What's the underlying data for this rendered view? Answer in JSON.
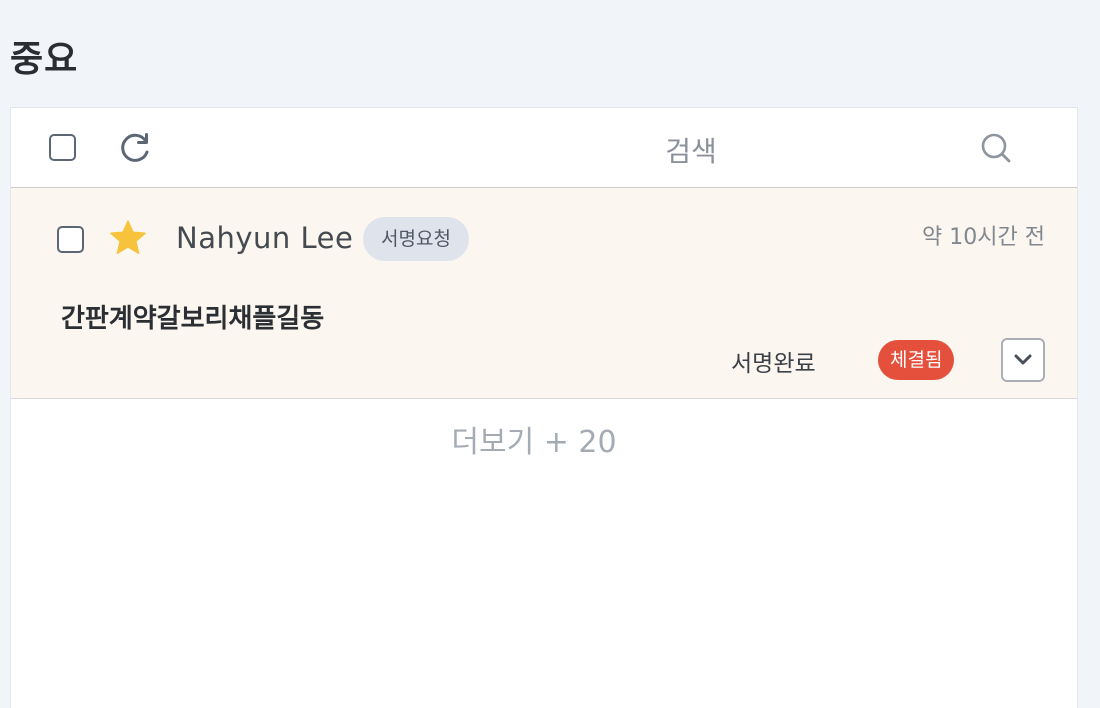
{
  "page": {
    "title": "중요"
  },
  "toolbar": {
    "search_label": "검색",
    "select_all_icon": "checkbox-empty",
    "refresh_icon": "refresh-icon",
    "search_icon": "search-icon"
  },
  "messages": [
    {
      "sender": "Nahyun Lee",
      "request_badge": "서명요청",
      "time": "약 10시간 전",
      "title": "간판계약갈보리채플길동",
      "sign_status": "서명완료",
      "state_badge": "체결됨",
      "starred": true
    }
  ],
  "more": {
    "label": "더보기 + 20"
  },
  "colors": {
    "background": "#f1f4f9",
    "row_highlight": "#fbf6ef",
    "badge_request": "#dfe3ec",
    "badge_done": "#e4503c",
    "star": "#f7c23c"
  }
}
